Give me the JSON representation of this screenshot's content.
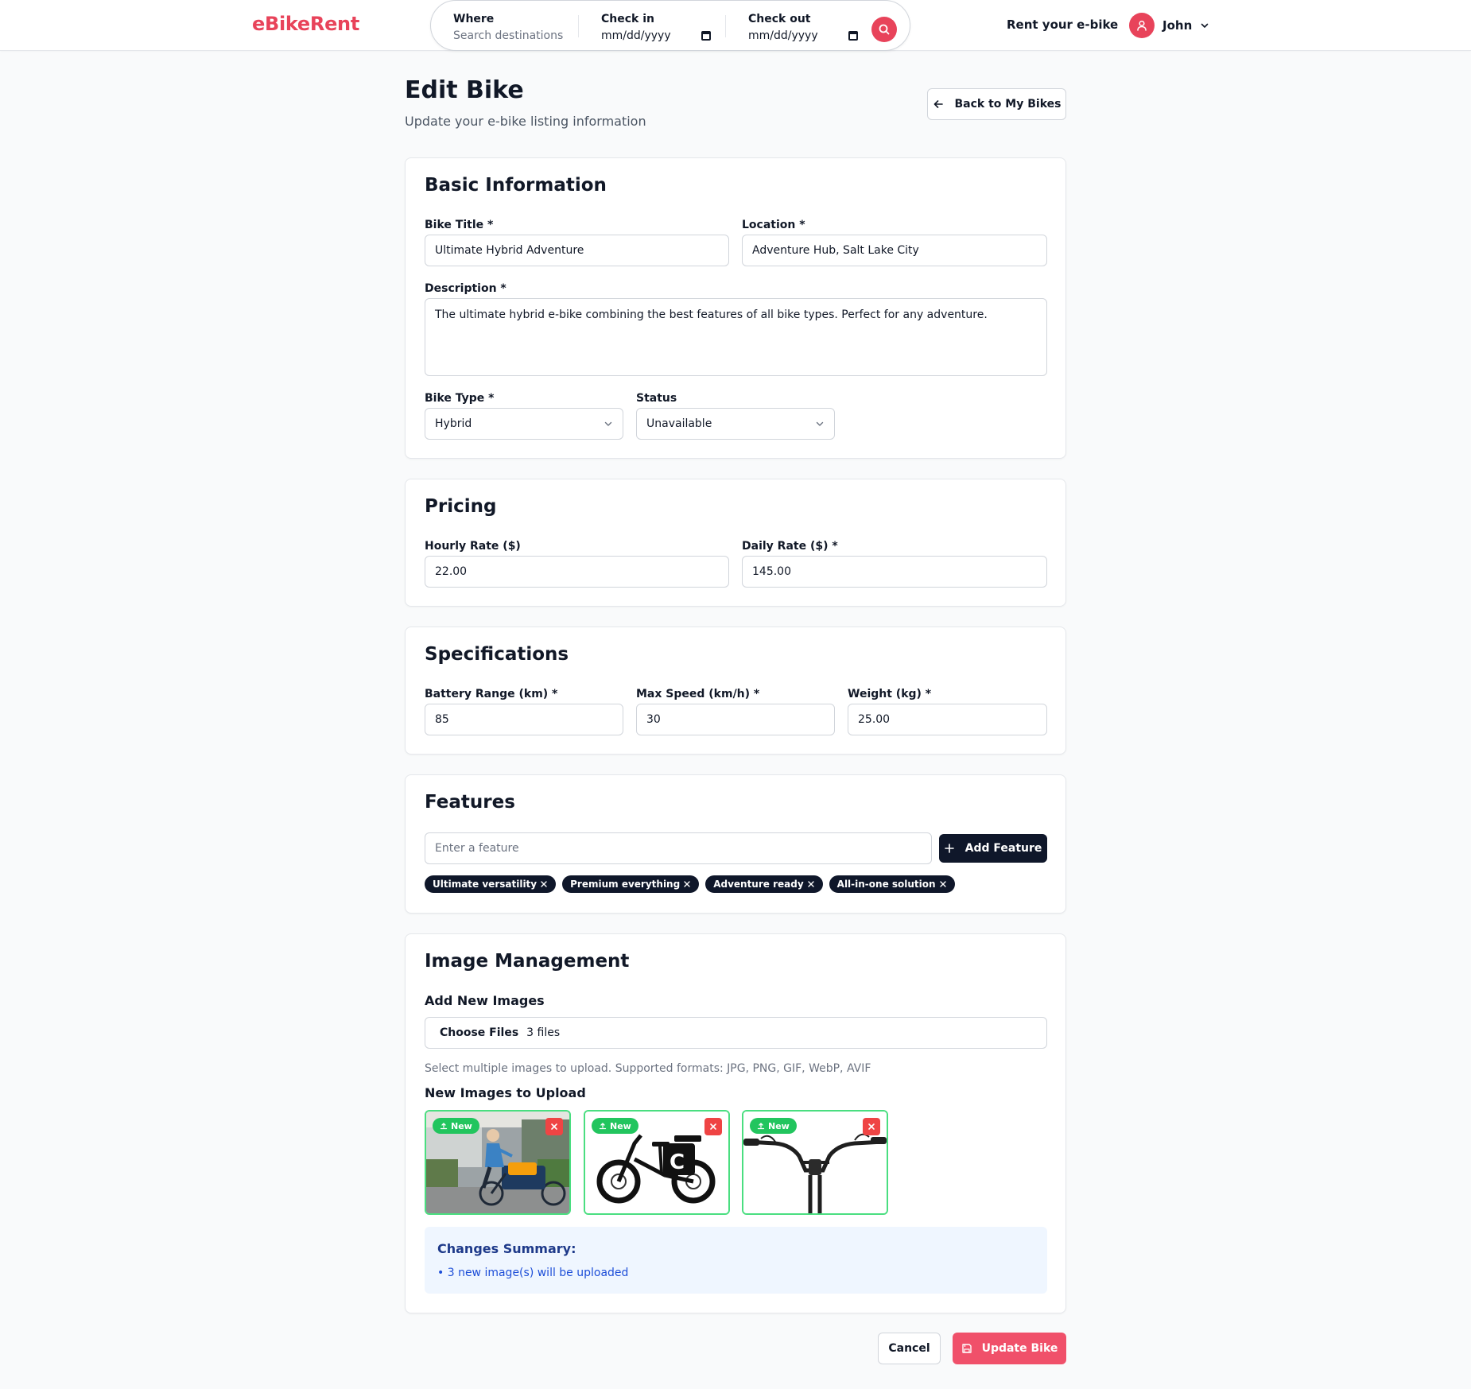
{
  "brand": {
    "name": "eBikeRent",
    "color": "#e8435a"
  },
  "search": {
    "where_label": "Where",
    "where_placeholder": "Search destinations",
    "checkin_label": "Check in",
    "checkin_value": "mm/dd/yyyy",
    "checkout_label": "Check out",
    "checkout_value": "mm/dd/yyyy",
    "button_icon": "search-icon"
  },
  "nav": {
    "rent_link": "Rent your e-bike",
    "user_name": "John",
    "user_icon": "user-icon"
  },
  "header": {
    "title": "Edit Bike",
    "subtitle": "Update your e-bike listing information",
    "back_button": "Back to My Bikes"
  },
  "basic_info": {
    "title": "Basic Information",
    "bike_title_label": "Bike Title *",
    "bike_title_value": "Ultimate Hybrid Adventure",
    "location_label": "Location *",
    "location_value": "Adventure Hub, Salt Lake City",
    "description_label": "Description *",
    "description_value": "The ultimate hybrid e-bike combining the best features of all bike types. Perfect for any adventure.",
    "bike_type_label": "Bike Type *",
    "bike_type_value": "Hybrid",
    "status_label": "Status",
    "status_value": "Unavailable"
  },
  "pricing": {
    "title": "Pricing",
    "hourly_label": "Hourly Rate ($)",
    "hourly_value": "22.00",
    "daily_label": "Daily Rate ($) *",
    "daily_value": "145.00"
  },
  "specs": {
    "title": "Specifications",
    "battery_label": "Battery Range (km) *",
    "battery_value": "85",
    "speed_label": "Max Speed (km/h) *",
    "speed_value": "30",
    "weight_label": "Weight (kg) *",
    "weight_value": "25.00"
  },
  "features": {
    "title": "Features",
    "input_placeholder": "Enter a feature",
    "add_button": "Add Feature",
    "chips": [
      "Ultimate versatility",
      "Premium everything",
      "Adventure ready",
      "All-in-one solution"
    ]
  },
  "images": {
    "title": "Image Management",
    "add_label": "Add New Images",
    "choose_button": "Choose Files",
    "file_count": "3 files",
    "help_text": "Select multiple images to upload. Supported formats: JPG, PNG, GIF, WebP, AVIF",
    "new_label": "New Images to Upload",
    "badge": "New",
    "thumbnails": [
      "cargo-bike-rider-photo",
      "folding-ebike-photo",
      "bmx-handlebar-photo"
    ],
    "summary_title": "Changes Summary:",
    "summary_item": "• 3 new image(s) will be uploaded"
  },
  "actions": {
    "cancel": "Cancel",
    "update": "Update Bike"
  }
}
